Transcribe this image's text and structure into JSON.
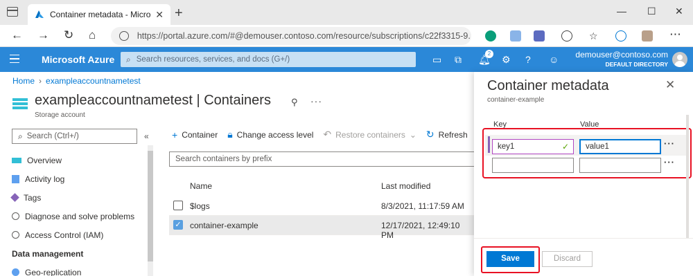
{
  "browser": {
    "tab_title": "Container metadata - Microsoft Azure",
    "url": "https://portal.azure.com/#@demouser.contoso.com/resource/subscriptions/c22f3315-9..."
  },
  "azure": {
    "brand": "Microsoft Azure",
    "search_placeholder": "Search resources, services, and docs (G+/)",
    "notification_count": "2",
    "user_email": "demouser@contoso.com",
    "user_directory": "DEFAULT DIRECTORY"
  },
  "breadcrumb": {
    "home": "Home",
    "resource": "exampleaccountnametest"
  },
  "resource": {
    "name": "exampleaccountnametest",
    "separator": " | ",
    "section": "Containers",
    "type": "Storage account"
  },
  "sidebar": {
    "search_placeholder": "Search (Ctrl+/)",
    "items": [
      {
        "label": "Overview"
      },
      {
        "label": "Activity log"
      },
      {
        "label": "Tags"
      },
      {
        "label": "Diagnose and solve problems"
      },
      {
        "label": "Access Control (IAM)"
      }
    ],
    "section_title": "Data management",
    "section_items": [
      {
        "label": "Geo-replication"
      }
    ]
  },
  "toolbar": {
    "add_container": "Container",
    "change_access": "Change access level",
    "restore": "Restore containers",
    "refresh": "Refresh"
  },
  "containers": {
    "search_placeholder": "Search containers by prefix",
    "col_name": "Name",
    "col_modified": "Last modified",
    "rows": [
      {
        "name": "$logs",
        "modified": "8/3/2021, 11:17:59 AM",
        "selected": false
      },
      {
        "name": "container-example",
        "modified": "12/17/2021, 12:49:10 PM",
        "selected": true
      }
    ]
  },
  "panel": {
    "title": "Container metadata",
    "subtitle": "container-example",
    "col_key": "Key",
    "col_value": "Value",
    "rows": [
      {
        "key": "key1",
        "value": "value1"
      },
      {
        "key": "",
        "value": ""
      }
    ],
    "save_label": "Save",
    "discard_label": "Discard"
  }
}
